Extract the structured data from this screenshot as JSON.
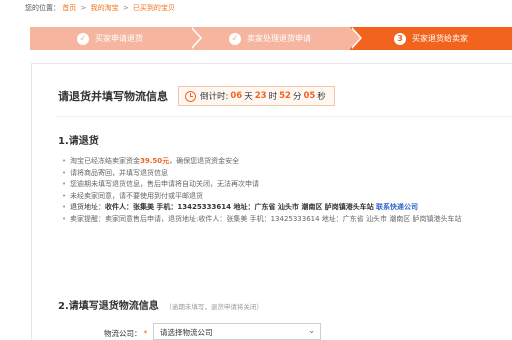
{
  "breadcrumb": {
    "prefix": "您的位置：",
    "items": [
      "首页",
      "我的淘宝",
      "已买到的宝贝"
    ],
    "separator": ">"
  },
  "steps": [
    {
      "label": "买家申请退货",
      "state": "done"
    },
    {
      "label": "卖家处理退货申请",
      "state": "done"
    },
    {
      "label": "买家退货给卖家",
      "state": "active",
      "number": "3"
    }
  ],
  "header": {
    "title": "请退货并填写物流信息",
    "countdown": {
      "prefix": "倒计时:",
      "days": "06",
      "days_unit": "天",
      "hours": "23",
      "hours_unit": "时",
      "minutes": "52",
      "minutes_unit": "分",
      "seconds": "05",
      "seconds_unit": "秒"
    }
  },
  "section1": {
    "title": "1.请退货",
    "notes": {
      "n1_a": "淘宝已经冻结卖家资金",
      "n1_price": "39.50元",
      "n1_b": "，确保您退货资金安全",
      "n2": "请将商品寄回，并填写退货信息",
      "n3": "您逾期未填写退货信息，售后申请将自动关闭，无法再次申请",
      "n4": "未经卖家同意，请不要使用到付或平邮退货",
      "n5_label": "退货地址：",
      "n5_value": "收件人：张集美 手机：13425333614 地址：广东省 汕头市 潮南区 胪岗镇港头车站",
      "n5_link": "联系快递公司",
      "n6": "卖家提醒：卖家同意售后申请，退货地址:收件人：张集美 手机：13425333614 地址：广东省 汕头市 潮南区 胪岗镇港头车站"
    }
  },
  "section2": {
    "title": "2.请填写退货物流信息",
    "hint": "（逾期未填写，退货申请将关闭）",
    "logistics_label": "物流公司：",
    "required_mark": "*",
    "logistics_value": "请选择物流公司"
  },
  "colors": {
    "accent": "#f2631e",
    "step_done": "#f6b59f",
    "link": "#3366cc"
  },
  "icons": [
    "check-icon",
    "step-number-icon",
    "clock-icon",
    "chevron-down-icon"
  ]
}
